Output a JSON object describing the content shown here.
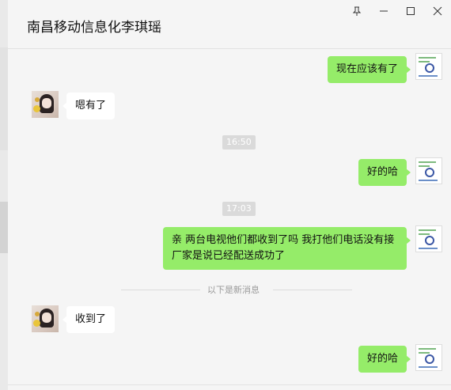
{
  "window": {
    "pin_icon": "pin-icon",
    "minimize_icon": "minimize-icon",
    "maximize_icon": "maximize-icon",
    "close_icon": "close-icon"
  },
  "chat": {
    "title": "南昌移动信息化李琪瑶"
  },
  "messages": [
    {
      "side": "mine",
      "text": "现在应该有了"
    },
    {
      "side": "other",
      "text": "嗯有了"
    },
    {
      "type": "time",
      "text": "16:50"
    },
    {
      "side": "mine",
      "text": "好的哈"
    },
    {
      "type": "time",
      "text": "17:03"
    },
    {
      "side": "mine",
      "text": "亲 两台电视他们都收到了吗 我打他们电话没有接 厂家是说已经配送成功了"
    },
    {
      "type": "divider",
      "text": "以下是新消息"
    },
    {
      "side": "other",
      "text": "收到了"
    },
    {
      "side": "mine",
      "text": "好的哈"
    }
  ],
  "colors": {
    "mine_bubble": "#95ec69",
    "other_bubble": "#ffffff",
    "background": "#f5f5f5"
  }
}
